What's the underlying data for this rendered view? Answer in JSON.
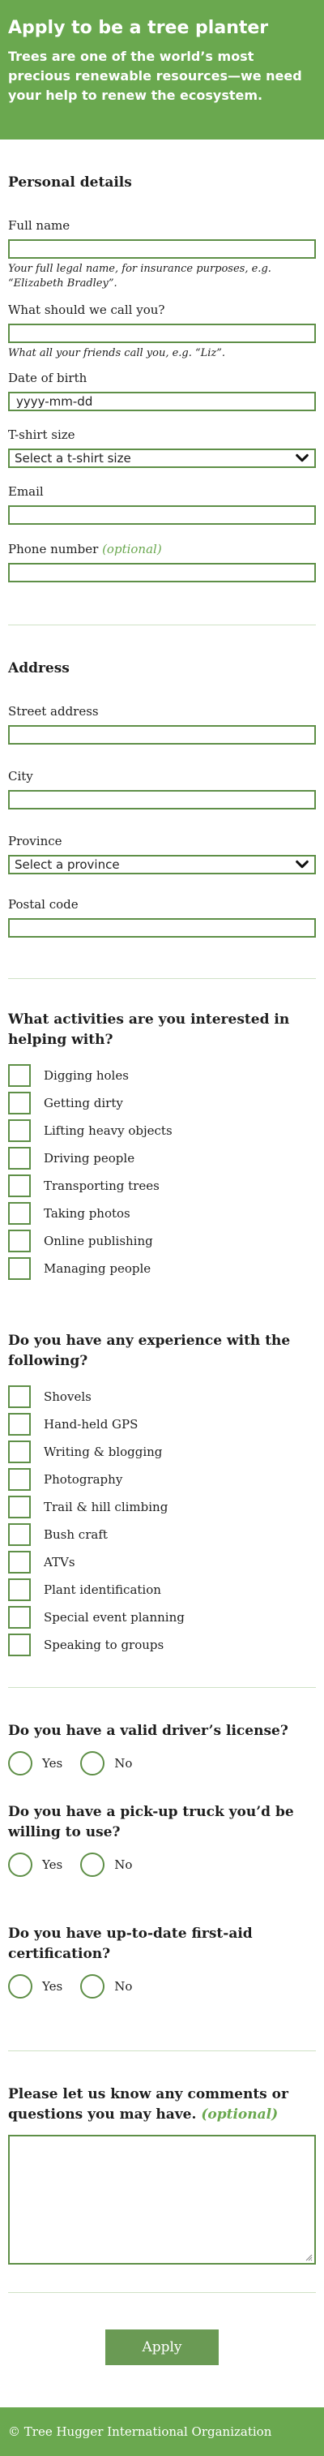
{
  "header": {
    "title": "Apply to be a tree planter",
    "intro": "Trees are one of the world’s most precious renewable resources—we need your help to renew the ecosystem."
  },
  "personal": {
    "heading": "Personal details",
    "full_name_label": "Full name",
    "full_name_hint": "Your full legal name, for insurance purposes, e.g. “Elizabeth Bradley”.",
    "call_label": "What should we call you?",
    "call_hint": "What all your friends call you, e.g. “Liz”.",
    "dob_label": "Date of birth",
    "dob_placeholder": "yyyy-mm-dd",
    "tshirt_label": "T-shirt size",
    "tshirt_selected": "Select a t-shirt size",
    "email_label": "Email",
    "phone_label": "Phone number",
    "phone_optional": "(optional)"
  },
  "address": {
    "heading": "Address",
    "street_label": "Street address",
    "city_label": "City",
    "province_label": "Province",
    "province_selected": "Select a province",
    "postal_label": "Postal code"
  },
  "activities": {
    "heading": "What activities are you interested in helping with?",
    "items": [
      "Digging holes",
      "Getting dirty",
      "Lifting heavy objects",
      "Driving people",
      "Transporting trees",
      "Taking photos",
      "Online publishing",
      "Managing people"
    ]
  },
  "experience": {
    "heading": "Do you have any experience with the following?",
    "items": [
      "Shovels",
      "Hand-held GPS",
      "Writing & blogging",
      "Photography",
      "Trail & hill climbing",
      "Bush craft",
      "ATVs",
      "Plant identification",
      "Special event planning",
      "Speaking to groups"
    ]
  },
  "questions": [
    {
      "heading": "Do you have a valid driver’s license?",
      "yes": "Yes",
      "no": "No"
    },
    {
      "heading": "Do you have a pick-up truck you’d be willing to use?",
      "yes": "Yes",
      "no": "No"
    },
    {
      "heading": "Do you have up-to-date first-aid certification?",
      "yes": "Yes",
      "no": "No"
    }
  ],
  "comments": {
    "heading": "Please let us know any comments or questions you may have.",
    "optional": "(optional)"
  },
  "submit_label": "Apply",
  "footer_text": "© Tree Hugger International Organization",
  "colors": {
    "brand_green": "#6aa84f",
    "border_green": "#5e8f47",
    "button_green": "#6a9a54"
  }
}
